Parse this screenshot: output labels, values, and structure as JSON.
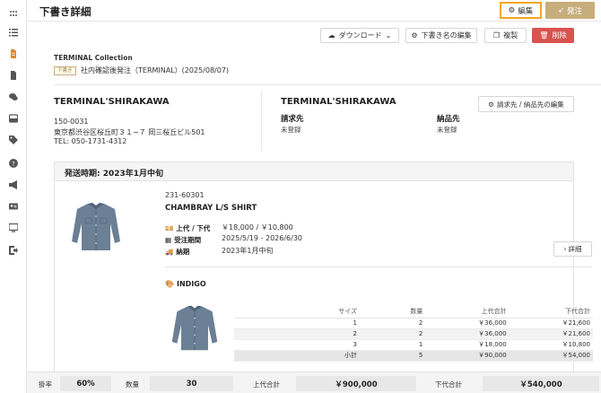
{
  "header": {
    "title": "下書き詳細",
    "edit_label": "編集",
    "order_label": "発注"
  },
  "toolbar": {
    "download_label": "ダウンロード",
    "rename_label": "下書き名の編集",
    "copy_label": "複製",
    "delete_label": "削除"
  },
  "draft": {
    "collection": "TERMINAL Collection",
    "badge": "下書き",
    "name": "社内確認後発注（TERMINAL）(2025/08/07)"
  },
  "address": {
    "left_name": "TERMINAL'SHIRAKAWA",
    "postal": "150-0031",
    "street": "東京都渋谷区桜丘町３１−７ 岡三桜丘ビル501",
    "tel": "TEL: 050-1731-4312",
    "right_name": "TERMINAL'SHIRAKAWA",
    "billto_label": "請求先",
    "billto_value": "未登録",
    "shipto_label": "納品先",
    "shipto_value": "未登録",
    "edit_billto_label": "請求先 / 納品先の編集"
  },
  "shipping": {
    "title": "発送時期: 2023年1月中旬",
    "product": {
      "code": "231-60301",
      "name": "CHAMBRAY L/S SHIRT",
      "price_label": "上代 / 下代",
      "price_value": "￥18,000 / ￥10,800",
      "period_label": "受注期間",
      "period_value": "2025/5/19 - 2026/6/30",
      "delivery_label": "納期",
      "delivery_value": "2023年1月中旬",
      "detail_label": "詳細"
    },
    "color": "INDIGO",
    "table": {
      "headers": [
        "サイズ",
        "数量",
        "上代合計",
        "下代合計"
      ],
      "rows": [
        [
          "1",
          "2",
          "￥36,000",
          "￥21,600"
        ],
        [
          "2",
          "2",
          "￥36,000",
          "￥21,600"
        ],
        [
          "3",
          "1",
          "￥18,000",
          "￥10,800"
        ]
      ],
      "subtotal": [
        "小計",
        "5",
        "￥90,000",
        "￥54,000"
      ]
    }
  },
  "footer": {
    "rate_label": "掛率",
    "rate_value": "60%",
    "qty_label": "数量",
    "qty_value": "30",
    "retail_label": "上代合計",
    "retail_value": "￥900,000",
    "wholesale_label": "下代合計",
    "wholesale_value": "￥540,000"
  },
  "colors": {
    "accent": "#c8ad7c",
    "edit_border": "#f5a623",
    "danger": "#d9534f"
  },
  "sidebar": {
    "icons": [
      "grid-icon",
      "list-icon",
      "document-active-icon",
      "file-icon",
      "chat-icon",
      "inbox-icon",
      "tag-icon",
      "help-icon",
      "megaphone-icon",
      "id-card-icon",
      "monitor-icon",
      "logout-icon"
    ]
  }
}
